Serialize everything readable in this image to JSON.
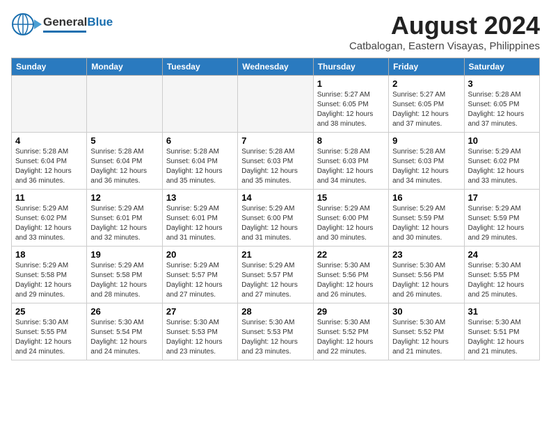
{
  "header": {
    "logo_general": "General",
    "logo_blue": "Blue",
    "month_year": "August 2024",
    "location": "Catbalogan, Eastern Visayas, Philippines"
  },
  "days_of_week": [
    "Sunday",
    "Monday",
    "Tuesday",
    "Wednesday",
    "Thursday",
    "Friday",
    "Saturday"
  ],
  "weeks": [
    [
      {
        "day": "",
        "sunrise": "",
        "sunset": "",
        "daylight": "",
        "empty": true
      },
      {
        "day": "",
        "sunrise": "",
        "sunset": "",
        "daylight": "",
        "empty": true
      },
      {
        "day": "",
        "sunrise": "",
        "sunset": "",
        "daylight": "",
        "empty": true
      },
      {
        "day": "",
        "sunrise": "",
        "sunset": "",
        "daylight": "",
        "empty": true
      },
      {
        "day": "1",
        "sunrise": "5:27 AM",
        "sunset": "6:05 PM",
        "daylight": "12 hours and 38 minutes."
      },
      {
        "day": "2",
        "sunrise": "5:27 AM",
        "sunset": "6:05 PM",
        "daylight": "12 hours and 37 minutes."
      },
      {
        "day": "3",
        "sunrise": "5:28 AM",
        "sunset": "6:05 PM",
        "daylight": "12 hours and 37 minutes."
      }
    ],
    [
      {
        "day": "4",
        "sunrise": "5:28 AM",
        "sunset": "6:04 PM",
        "daylight": "12 hours and 36 minutes."
      },
      {
        "day": "5",
        "sunrise": "5:28 AM",
        "sunset": "6:04 PM",
        "daylight": "12 hours and 36 minutes."
      },
      {
        "day": "6",
        "sunrise": "5:28 AM",
        "sunset": "6:04 PM",
        "daylight": "12 hours and 35 minutes."
      },
      {
        "day": "7",
        "sunrise": "5:28 AM",
        "sunset": "6:03 PM",
        "daylight": "12 hours and 35 minutes."
      },
      {
        "day": "8",
        "sunrise": "5:28 AM",
        "sunset": "6:03 PM",
        "daylight": "12 hours and 34 minutes."
      },
      {
        "day": "9",
        "sunrise": "5:28 AM",
        "sunset": "6:03 PM",
        "daylight": "12 hours and 34 minutes."
      },
      {
        "day": "10",
        "sunrise": "5:29 AM",
        "sunset": "6:02 PM",
        "daylight": "12 hours and 33 minutes."
      }
    ],
    [
      {
        "day": "11",
        "sunrise": "5:29 AM",
        "sunset": "6:02 PM",
        "daylight": "12 hours and 33 minutes."
      },
      {
        "day": "12",
        "sunrise": "5:29 AM",
        "sunset": "6:01 PM",
        "daylight": "12 hours and 32 minutes."
      },
      {
        "day": "13",
        "sunrise": "5:29 AM",
        "sunset": "6:01 PM",
        "daylight": "12 hours and 31 minutes."
      },
      {
        "day": "14",
        "sunrise": "5:29 AM",
        "sunset": "6:00 PM",
        "daylight": "12 hours and 31 minutes."
      },
      {
        "day": "15",
        "sunrise": "5:29 AM",
        "sunset": "6:00 PM",
        "daylight": "12 hours and 30 minutes."
      },
      {
        "day": "16",
        "sunrise": "5:29 AM",
        "sunset": "5:59 PM",
        "daylight": "12 hours and 30 minutes."
      },
      {
        "day": "17",
        "sunrise": "5:29 AM",
        "sunset": "5:59 PM",
        "daylight": "12 hours and 29 minutes."
      }
    ],
    [
      {
        "day": "18",
        "sunrise": "5:29 AM",
        "sunset": "5:58 PM",
        "daylight": "12 hours and 29 minutes."
      },
      {
        "day": "19",
        "sunrise": "5:29 AM",
        "sunset": "5:58 PM",
        "daylight": "12 hours and 28 minutes."
      },
      {
        "day": "20",
        "sunrise": "5:29 AM",
        "sunset": "5:57 PM",
        "daylight": "12 hours and 27 minutes."
      },
      {
        "day": "21",
        "sunrise": "5:29 AM",
        "sunset": "5:57 PM",
        "daylight": "12 hours and 27 minutes."
      },
      {
        "day": "22",
        "sunrise": "5:30 AM",
        "sunset": "5:56 PM",
        "daylight": "12 hours and 26 minutes."
      },
      {
        "day": "23",
        "sunrise": "5:30 AM",
        "sunset": "5:56 PM",
        "daylight": "12 hours and 26 minutes."
      },
      {
        "day": "24",
        "sunrise": "5:30 AM",
        "sunset": "5:55 PM",
        "daylight": "12 hours and 25 minutes."
      }
    ],
    [
      {
        "day": "25",
        "sunrise": "5:30 AM",
        "sunset": "5:55 PM",
        "daylight": "12 hours and 24 minutes."
      },
      {
        "day": "26",
        "sunrise": "5:30 AM",
        "sunset": "5:54 PM",
        "daylight": "12 hours and 24 minutes."
      },
      {
        "day": "27",
        "sunrise": "5:30 AM",
        "sunset": "5:53 PM",
        "daylight": "12 hours and 23 minutes."
      },
      {
        "day": "28",
        "sunrise": "5:30 AM",
        "sunset": "5:53 PM",
        "daylight": "12 hours and 23 minutes."
      },
      {
        "day": "29",
        "sunrise": "5:30 AM",
        "sunset": "5:52 PM",
        "daylight": "12 hours and 22 minutes."
      },
      {
        "day": "30",
        "sunrise": "5:30 AM",
        "sunset": "5:52 PM",
        "daylight": "12 hours and 21 minutes."
      },
      {
        "day": "31",
        "sunrise": "5:30 AM",
        "sunset": "5:51 PM",
        "daylight": "12 hours and 21 minutes."
      }
    ]
  ],
  "labels": {
    "sunrise": "Sunrise:",
    "sunset": "Sunset:",
    "daylight": "Daylight:"
  }
}
